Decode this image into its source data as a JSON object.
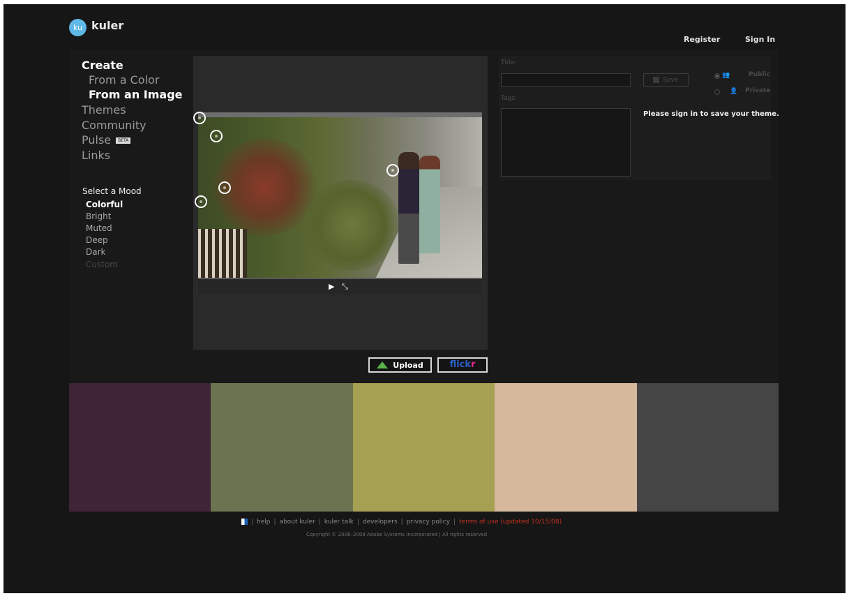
{
  "header": {
    "logo_badge": "ku",
    "logo_text": "kuler",
    "register_label": "Register",
    "signin_label": "Sign In"
  },
  "nav": {
    "create": "Create",
    "from_color": "From a Color",
    "from_image": "From an Image",
    "themes": "Themes",
    "community": "Community",
    "pulse": "Pulse",
    "pulse_badge": "BETA",
    "links": "Links"
  },
  "mood": {
    "heading": "Select a Mood",
    "options": [
      "Colorful",
      "Bright",
      "Muted",
      "Deep",
      "Dark",
      "Custom"
    ],
    "selected": "Colorful"
  },
  "image_panel": {
    "icons": [
      "color-picker-circle",
      "play-icon",
      "expand-icon"
    ]
  },
  "buttons": {
    "upload_label": "Upload",
    "flickr_main": "flick",
    "flickr_r": "r"
  },
  "form": {
    "title_label": "Title:",
    "title_value": "",
    "tags_label": "Tags:",
    "save_label": "Save",
    "public_label": "Public",
    "private_label": "Private",
    "signin_message": "Please sign in to save your theme."
  },
  "swatches": [
    {
      "name": "swatch-1",
      "color": "#3f2438"
    },
    {
      "name": "swatch-2",
      "color": "#6c7350"
    },
    {
      "name": "swatch-3",
      "color": "#a5a052"
    },
    {
      "name": "swatch-4",
      "color": "#d6b89c"
    },
    {
      "name": "swatch-5",
      "color": "#454545"
    }
  ],
  "footer": {
    "help": "help",
    "about": "about kuler",
    "talk": "kuler talk",
    "developers": "developers",
    "privacy": "privacy policy",
    "terms": "terms of use (updated 10/15/08)",
    "copyright": "Copyright © 2006–2008 Adobe Systems Incorporated | All rights reserved"
  }
}
